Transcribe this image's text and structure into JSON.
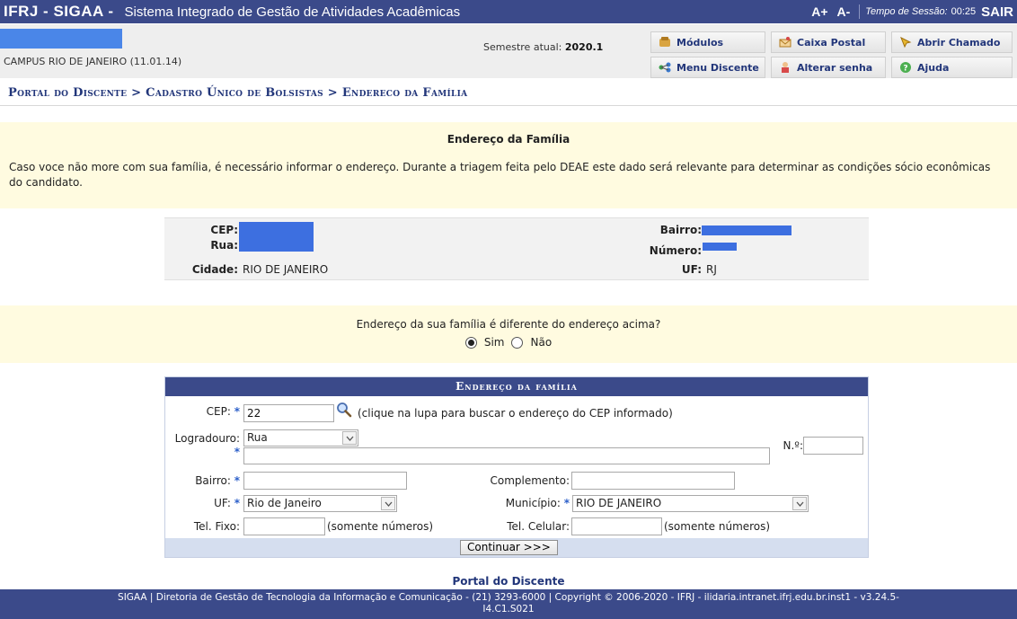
{
  "topbar": {
    "brand": "IFRJ - SIGAA -",
    "system_name": "Sistema Integrado de Gestão de Atividades Acadêmicas",
    "font_increase": "A+",
    "font_decrease": "A-",
    "session_label": "Tempo de Sessão:",
    "session_time": "00:25",
    "logout": "SAIR"
  },
  "header": {
    "campus": "CAMPUS RIO DE JANEIRO (11.01.14)",
    "semester_label": "Semestre atual:",
    "semester_value": "2020.1",
    "menu": [
      {
        "label": "Módulos",
        "icon": "modules-icon"
      },
      {
        "label": "Caixa Postal",
        "icon": "mailbox-icon"
      },
      {
        "label": "Abrir Chamado",
        "icon": "ticket-icon"
      },
      {
        "label": "Menu Discente",
        "icon": "student-menu-icon"
      },
      {
        "label": "Alterar senha",
        "icon": "password-icon"
      },
      {
        "label": "Ajuda",
        "icon": "help-icon"
      }
    ]
  },
  "breadcrumb": "Portal do Discente > Cadastro Único de Bolsistas > Endereco da Família",
  "description": {
    "title": "Endereço da Família",
    "text": "Caso voce não more com sua família, é necessário informar o endereço. Durante a triagem feita pelo DEAE este dado será relevante para determinar as condições sócio econômicas do candidato."
  },
  "address": {
    "cep_label": "CEP:",
    "rua_label": "Rua:",
    "cidade_label": "Cidade:",
    "cidade_value": "RIO DE JANEIRO",
    "bairro_label": "Bairro:",
    "numero_label": "Número:",
    "uf_label": "UF:",
    "uf_value": "RJ"
  },
  "question": {
    "text": "Endereço da sua família é diferente do endereço acima?",
    "option_yes": "Sim",
    "option_no": "Não",
    "selected": "Sim"
  },
  "form": {
    "title": "Endereço da família",
    "cep_label": "CEP:",
    "cep_value": "22",
    "cep_hint": "(clique na lupa para buscar o endereço do CEP informado)",
    "logradouro_label": "Logradouro:",
    "logradouro_type": "Rua",
    "logradouro_value": "",
    "numero_label": "N.º:",
    "numero_value": "",
    "bairro_label": "Bairro:",
    "bairro_value": "",
    "complemento_label": "Complemento:",
    "complemento_value": "",
    "uf_label": "UF:",
    "uf_value": "Rio de Janeiro",
    "municipio_label": "Município:",
    "municipio_value": "RIO DE JANEIRO",
    "tel_fixo_label": "Tel. Fixo:",
    "tel_fixo_value": "",
    "tel_fixo_hint": "(somente números)",
    "tel_celular_label": "Tel. Celular:",
    "tel_celular_value": "",
    "tel_celular_hint": "(somente números)",
    "submit": "Continuar >>>"
  },
  "footer": {
    "portal_link": "Portal do Discente",
    "line1": "SIGAA | Diretoria de Gestão de Tecnologia da Informação e Comunicação - (21) 3293-6000 | Copyright © 2006-2020 - IFRJ - ilidaria.intranet.ifrj.edu.br.inst1 - v3.24.5-",
    "line2": "I4.C1.S021"
  },
  "colors": {
    "primary": "#3b4a8a",
    "link": "#22367a",
    "highlight_bg": "#fffbe0",
    "required_star": "#2b5fc9",
    "redaction": "#3d6fe0"
  }
}
